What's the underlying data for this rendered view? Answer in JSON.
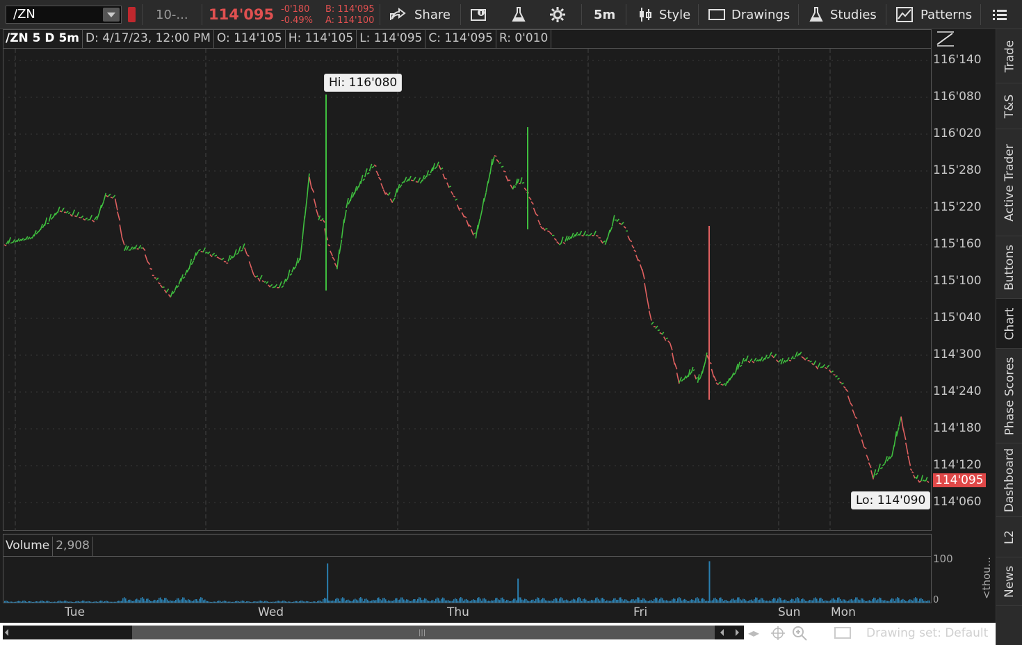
{
  "toolbar": {
    "symbol": "/ZN",
    "description": "10-...",
    "last_price": "114'095",
    "net_change": "-0'180",
    "pct_change": "-0.49%",
    "bid": "B: 114'095",
    "ask": "A: 114'100",
    "share_label": "Share",
    "timeframe_label": "5m",
    "style_label": "Style",
    "drawings_label": "Drawings",
    "studies_label": "Studies",
    "patterns_label": "Patterns"
  },
  "info_bar": {
    "symbol": "/ZN 5 D 5m",
    "date": "D: 4/17/23, 12:00 PM",
    "open": "O: 114'105",
    "high": "H: 114'105",
    "low": "L: 114'095",
    "close": "C: 114'095",
    "range": "R: 0'010"
  },
  "annotations": {
    "hi_label": "Hi: 116'080",
    "lo_label": "Lo: 114'090",
    "last_price_tag": "114'095"
  },
  "volume_bar": {
    "label": "Volume",
    "value": "2,908",
    "axis_top": "100",
    "axis_bottom": "0",
    "unit": "<thou..."
  },
  "sidebar": {
    "tabs": [
      "Trade",
      "T&S",
      "Active Trader",
      "Buttons",
      "Chart",
      "Phase Scores",
      "Dashboard",
      "L2",
      "News"
    ]
  },
  "bottom_bar": {
    "drawing_set": "Drawing set: Default"
  },
  "colors": {
    "up": "#3fbf3f",
    "down": "#e06060",
    "volume": "#2a7fb0",
    "price_red": "#e05050",
    "background": "#1c1c1c"
  },
  "chart_data": {
    "type": "line",
    "title": "/ZN 5 D 5m",
    "price_ticks": [
      "116'140",
      "116'080",
      "116'020",
      "115'280",
      "115'220",
      "115'160",
      "115'100",
      "115'040",
      "114'300",
      "114'240",
      "114'180",
      "114'120",
      "114'060"
    ],
    "time_ticks": [
      "Tue",
      "Wed",
      "Thu",
      "Fri",
      "Sun",
      "Mon"
    ],
    "ylim": [
      114.03,
      116.155
    ],
    "x": [
      0,
      0.03,
      0.06,
      0.09,
      0.1,
      0.11,
      0.12,
      0.13,
      0.15,
      0.16,
      0.18,
      0.2,
      0.21,
      0.22,
      0.23,
      0.24,
      0.26,
      0.27,
      0.29,
      0.3,
      0.32,
      0.33,
      0.34,
      0.345,
      0.35,
      0.36,
      0.37,
      0.39,
      0.4,
      0.41,
      0.42,
      0.43,
      0.44,
      0.45,
      0.47,
      0.49,
      0.5,
      0.51,
      0.53,
      0.54,
      0.55,
      0.555,
      0.56,
      0.57,
      0.58,
      0.59,
      0.6,
      0.62,
      0.64,
      0.65,
      0.66,
      0.67,
      0.69,
      0.7,
      0.72,
      0.73,
      0.74,
      0.745,
      0.75,
      0.755,
      0.76,
      0.77,
      0.78,
      0.8,
      0.82,
      0.83,
      0.84,
      0.86,
      0.88,
      0.89,
      0.91,
      0.92,
      0.93,
      0.94,
      0.95,
      0.96,
      0.97,
      0.98,
      0.985,
      0.99,
      0.995,
      1.0
    ],
    "y": [
      115.16,
      115.17,
      115.215,
      115.2,
      115.2,
      115.24,
      115.235,
      115.15,
      115.155,
      115.11,
      115.075,
      115.12,
      115.15,
      115.145,
      115.14,
      115.13,
      115.155,
      115.11,
      115.09,
      115.09,
      115.135,
      115.27,
      115.2,
      115.2,
      115.16,
      115.12,
      115.22,
      115.27,
      115.29,
      115.25,
      115.23,
      115.26,
      115.265,
      115.26,
      115.29,
      115.225,
      115.2,
      115.17,
      115.305,
      115.28,
      115.25,
      115.26,
      115.26,
      115.23,
      115.19,
      115.18,
      115.16,
      115.175,
      115.175,
      115.16,
      115.2,
      115.19,
      115.12,
      115.03,
      115.0,
      114.255,
      114.265,
      114.275,
      114.255,
      114.27,
      114.3,
      114.255,
      114.25,
      114.29,
      114.29,
      114.3,
      114.285,
      114.3,
      114.28,
      114.28,
      114.245,
      114.2,
      114.15,
      114.1,
      114.12,
      114.135,
      114.2,
      114.115,
      114.1,
      114.095,
      114.095,
      114.095
    ],
    "hi": 116.25,
    "lo": 114.09,
    "volume": {
      "ylim": [
        0,
        100
      ],
      "spikes": [
        {
          "x": 0.349,
          "value": 90
        },
        {
          "x": 0.555,
          "value": 55
        },
        {
          "x": 0.762,
          "value": 95
        }
      ]
    }
  }
}
